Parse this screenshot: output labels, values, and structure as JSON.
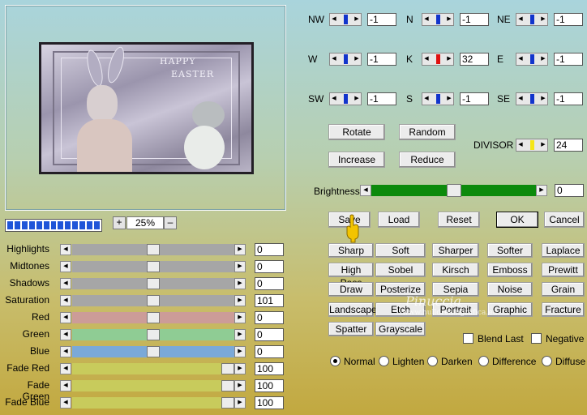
{
  "preview": {
    "art_text_line1": "HAPPY",
    "art_text_line2": "EASTER"
  },
  "zoom": {
    "plus": "+",
    "value": "25%",
    "minus": "–"
  },
  "left_sliders": [
    {
      "label": "Highlights",
      "value": "0",
      "level": 0.5,
      "track_color": "#a6a6a6"
    },
    {
      "label": "Midtones",
      "value": "0",
      "level": 0.5,
      "track_color": "#a6a6a6"
    },
    {
      "label": "Shadows",
      "value": "0",
      "level": 0.5,
      "track_color": "#a6a6a6"
    },
    {
      "label": "Saturation",
      "value": "101",
      "level": 0.5,
      "track_color": "#a6a6a6"
    },
    {
      "label": "Red",
      "value": "0",
      "level": 0.5,
      "track_color": "#cc9c98"
    },
    {
      "label": "Green",
      "value": "0",
      "level": 0.5,
      "track_color": "#8fcc94"
    },
    {
      "label": "Blue",
      "value": "0",
      "level": 0.5,
      "track_color": "#7ba9d8"
    },
    {
      "label": "Fade Red",
      "value": "100",
      "level": 1.0,
      "track_color": "#c8cb5c"
    },
    {
      "label": "Fade Green",
      "value": "100",
      "level": 1.0,
      "track_color": "#c8cb5c"
    },
    {
      "label": "Fade Blue",
      "value": "100",
      "level": 1.0,
      "track_color": "#c8cb5c"
    }
  ],
  "matrix": [
    {
      "label": "NW",
      "value": "-1",
      "marker": "#1234cc"
    },
    {
      "label": "N",
      "value": "-1",
      "marker": "#1234cc"
    },
    {
      "label": "NE",
      "value": "-1",
      "marker": "#1234cc"
    },
    {
      "label": "W",
      "value": "-1",
      "marker": "#1234cc"
    },
    {
      "label": "K",
      "value": "32",
      "marker": "#e01010"
    },
    {
      "label": "E",
      "value": "-1",
      "marker": "#1234cc"
    },
    {
      "label": "SW",
      "value": "-1",
      "marker": "#1234cc"
    },
    {
      "label": "S",
      "value": "-1",
      "marker": "#1234cc"
    },
    {
      "label": "SE",
      "value": "-1",
      "marker": "#1234cc"
    }
  ],
  "buttons": {
    "rotate": "Rotate",
    "random": "Random",
    "increase": "Increase",
    "reduce": "Reduce",
    "save": "Save",
    "load": "Load",
    "reset": "Reset",
    "ok": "OK",
    "cancel": "Cancel"
  },
  "divisor": {
    "label": "DIVISOR",
    "value": "24",
    "marker": "#f5e617"
  },
  "brightness": {
    "label": "Brightness",
    "value": "0",
    "level": 0.5,
    "track_color": "#0c8a0c"
  },
  "presets": [
    [
      "Sharp",
      "Soft",
      "Sharper",
      "Softer",
      "Laplace"
    ],
    [
      "High Pass",
      "Sobel",
      "Kirsch",
      "Emboss",
      "Prewitt"
    ],
    [
      "Draw",
      "Posterize",
      "Sepia",
      "Noise",
      "Grain"
    ],
    [
      "Landscape",
      "Etch",
      "Portrait",
      "Graphic",
      "Fracture"
    ],
    [
      "Spatter",
      "Grayscale"
    ]
  ],
  "checkboxes": {
    "blend_last": "Blend Last",
    "negative": "Negative"
  },
  "blend_modes": {
    "normal": "Normal",
    "lighten": "Lighten",
    "darken": "Darken",
    "difference": "Difference",
    "diffuse": "Diffuse"
  },
  "watermark": {
    "line1": "Pinuccia",
    "line2": "www.hulldreamgrafica.eu"
  }
}
